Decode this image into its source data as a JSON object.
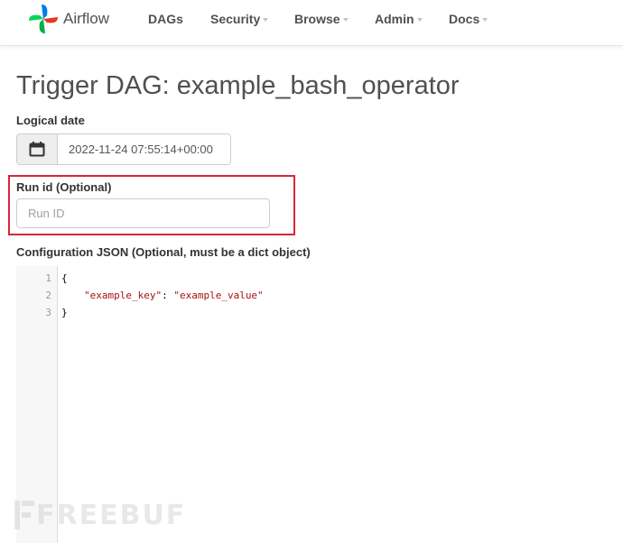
{
  "app": {
    "brand": "Airflow"
  },
  "nav": {
    "items": [
      {
        "label": "DAGs",
        "has_caret": false
      },
      {
        "label": "Security",
        "has_caret": true
      },
      {
        "label": "Browse",
        "has_caret": true
      },
      {
        "label": "Admin",
        "has_caret": true
      },
      {
        "label": "Docs",
        "has_caret": true
      }
    ]
  },
  "page": {
    "title": "Trigger DAG: example_bash_operator"
  },
  "form": {
    "logical_date": {
      "label": "Logical date",
      "value": "2022-11-24 07:55:14+00:00",
      "icon": "calendar-icon"
    },
    "run_id": {
      "label": "Run id (Optional)",
      "placeholder": "Run ID",
      "value": ""
    },
    "config": {
      "label": "Configuration JSON (Optional, must be a dict object)",
      "lines": [
        {
          "num": "1",
          "text": "{"
        },
        {
          "num": "2",
          "key": "\"example_key\"",
          "sep": ": ",
          "value": "\"example_value\""
        },
        {
          "num": "3",
          "text": "}"
        }
      ]
    }
  },
  "watermark": {
    "text": "FREEBUF"
  },
  "colors": {
    "highlight": "#d9263a",
    "string": "#aa1111",
    "text": "#51504f"
  }
}
